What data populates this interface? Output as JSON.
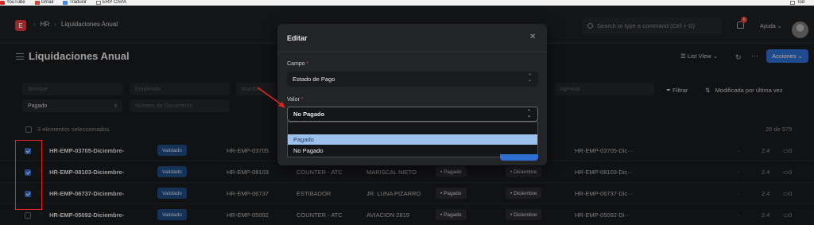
{
  "bookmarks": {
    "items": [
      {
        "label": "YouTube",
        "color": "#e02424"
      },
      {
        "label": "Gmail",
        "color": "#d44638"
      },
      {
        "label": "Traducir",
        "color": "#4a86e8"
      },
      {
        "label": "ERP CAPA",
        "color": "#777777"
      }
    ],
    "right_label": "Tod"
  },
  "navbar": {
    "logo_letter": "E",
    "breadcrumb": [
      "HR",
      "Liquidaciones Anual"
    ],
    "search_placeholder": "Search or type a command (Ctrl + G)",
    "notification_count": "6",
    "help_label": "Ayuda"
  },
  "page": {
    "title": "Liquidaciones Anual",
    "list_view_label": "List View",
    "actions_label": "Acciones"
  },
  "filters": {
    "row1": [
      "Nombre",
      "Empleado",
      "Nombre"
    ],
    "row1_right": "Agencia",
    "row2_value": "Pagado",
    "row2_placeholder": "Número de Documento",
    "filter_label": "Filtrar",
    "sort_label": "Modificada por última vez"
  },
  "list": {
    "selected_label": "3 elementos seleccionados",
    "count_label": "20 de 575",
    "rows": [
      {
        "checked": true,
        "name": "HR-EMP-03705-Diciembre-",
        "status": "Validado",
        "employee": "HR-EMP-03705",
        "dept": "",
        "addr": "",
        "pay": "",
        "month": "",
        "id": "HR-EMP-03705-Dic···",
        "dash": "-",
        "num": "2.4",
        "comments": "0"
      },
      {
        "checked": true,
        "name": "HR-EMP-08103-Diciembre-",
        "status": "Validado",
        "employee": "HR-EMP-08103",
        "dept": "COUNTER - ATC",
        "addr": "MARISCAL NIETO",
        "pay": "Pagado",
        "month": "Diciembre",
        "id": "HR-EMP-08103-Dic···",
        "dash": "-",
        "num": "2.4",
        "comments": "0"
      },
      {
        "checked": true,
        "name": "HR-EMP-06737-Diciembre-",
        "status": "Validado",
        "employee": "HR-EMP-06737",
        "dept": "ESTIBADOR",
        "addr": "JR. LUNA PIZARRO",
        "pay": "Pagado",
        "month": "Diciembre",
        "id": "HR-EMP-06737-Dic···",
        "dash": "-",
        "num": "2.4",
        "comments": "0"
      },
      {
        "checked": false,
        "name": "HR-EMP-05092-Diciembre-",
        "status": "Validado",
        "employee": "HR-EMP-05092",
        "dept": "COUNTER - ATC",
        "addr": "AVIACION 2819",
        "pay": "Pagado",
        "month": "Diciembre",
        "id": "HR-EMP-05092-Di···",
        "dash": "-",
        "num": "2.4",
        "comments": "0"
      }
    ]
  },
  "modal": {
    "title": "Editar",
    "campo_label": "Campo",
    "campo_value": "Estado de Pago",
    "valor_label": "Valor",
    "valor_value": "No Pagado",
    "required_mark": "*",
    "options": [
      "Pagado",
      "No Pagado"
    ]
  },
  "colors": {
    "accent": "#2f6fd1",
    "highlight_box": "#e02424",
    "dropdown_hover": "#9cc1ec"
  }
}
